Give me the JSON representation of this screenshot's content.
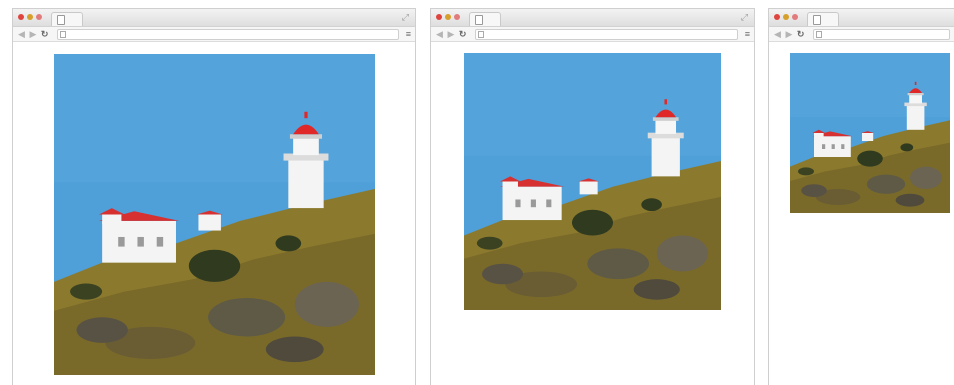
{
  "colors": {
    "sky": "#4f9fd8",
    "lighthouse_cap": "#e02828",
    "hill": "#8b7a2e"
  },
  "windows": [
    {
      "name": "large",
      "tab_icon": "page-icon",
      "reload_glyph": "↻",
      "back_glyph": "◀",
      "forward_glyph": "▶",
      "menu_glyph": "≡"
    },
    {
      "name": "medium",
      "tab_icon": "page-icon",
      "reload_glyph": "↻",
      "back_glyph": "◀",
      "forward_glyph": "▶",
      "menu_glyph": "≡"
    },
    {
      "name": "small",
      "tab_icon": "page-icon",
      "reload_glyph": "↻",
      "back_glyph": "◀",
      "forward_glyph": "▶",
      "menu_glyph": "≡"
    }
  ]
}
